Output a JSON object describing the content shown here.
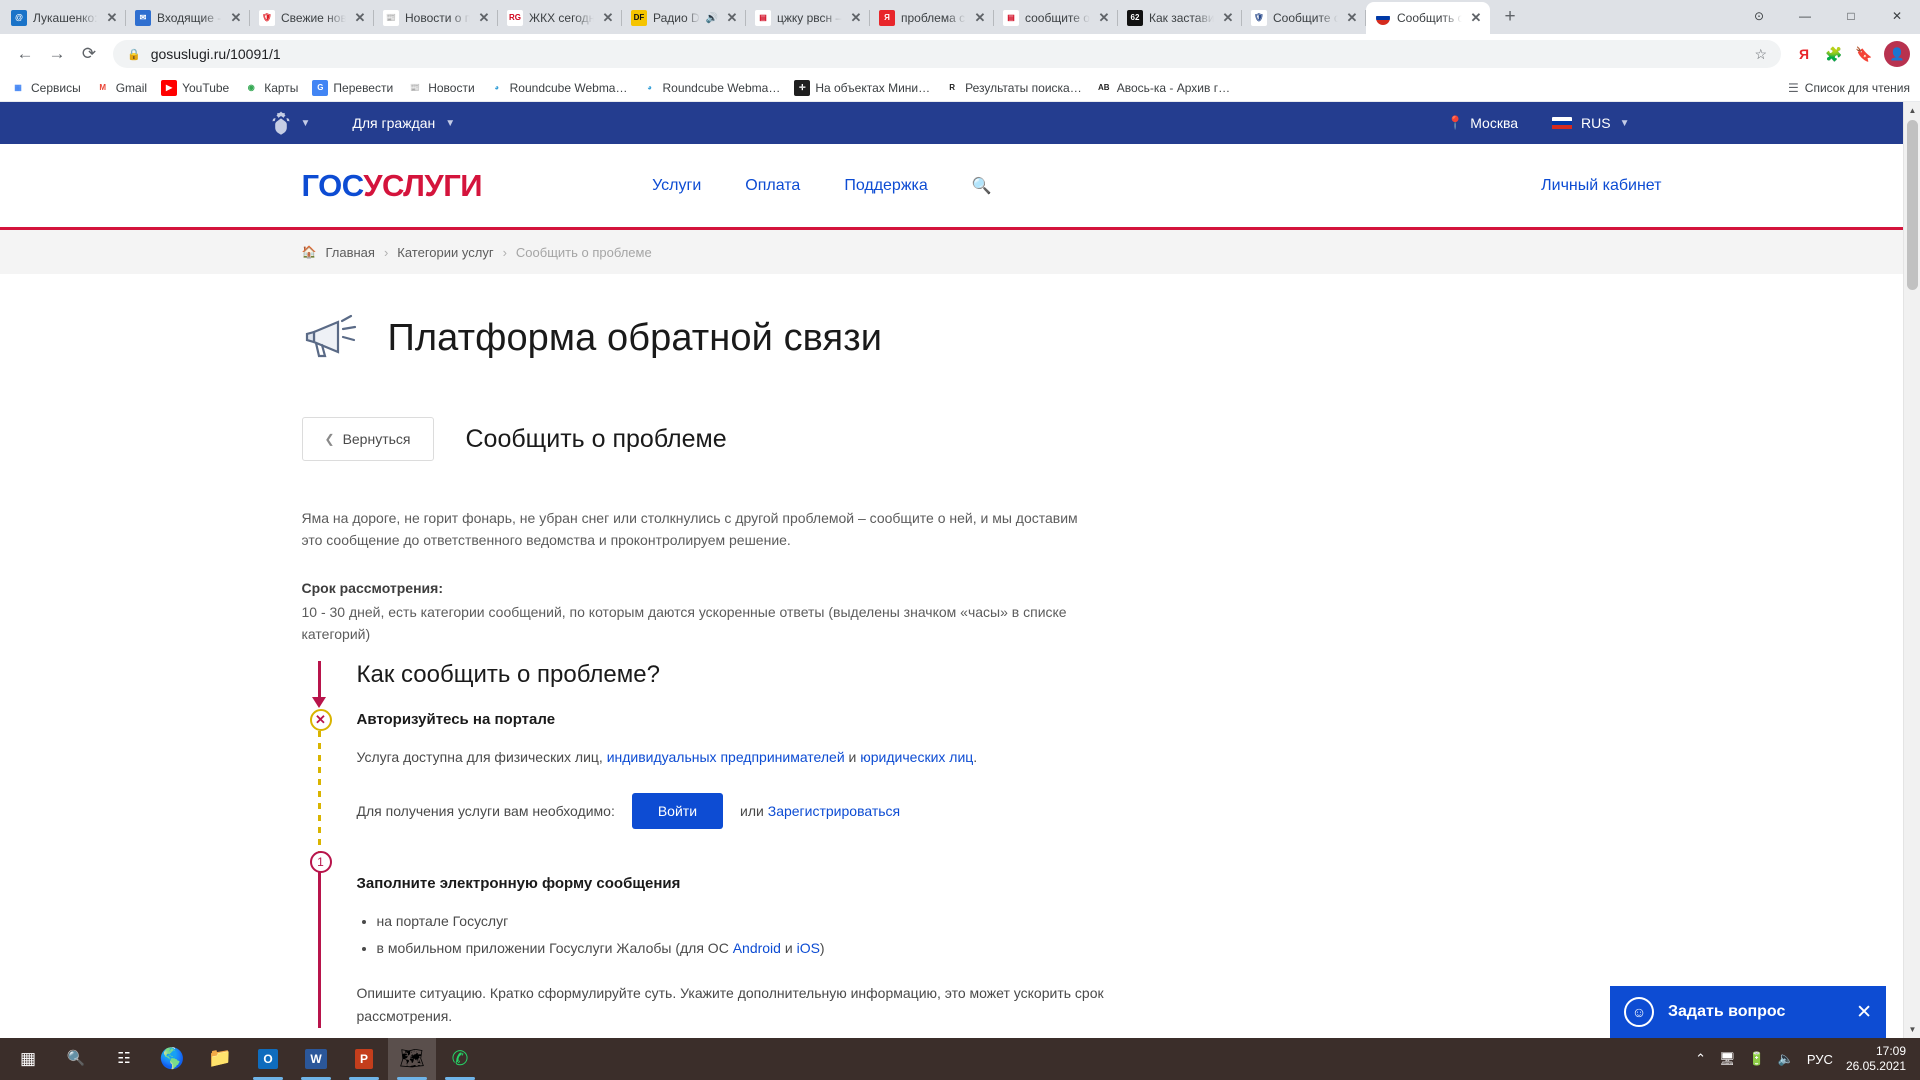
{
  "browser": {
    "tabs": [
      {
        "title": "Лукашенко: Г",
        "favicon": "at-blue",
        "active": false
      },
      {
        "title": "Входящие - П",
        "favicon": "mail-blue",
        "active": false
      },
      {
        "title": "Свежие новос",
        "favicon": "shield-red",
        "active": false
      },
      {
        "title": "Новости о по",
        "favicon": "news-red",
        "active": false
      },
      {
        "title": "ЖКХ сегодня",
        "favicon": "rg-ru",
        "active": false
      },
      {
        "title": "Радио DF",
        "favicon": "dfm-yellow",
        "active": false,
        "audio": true
      },
      {
        "title": "цжку рвсн – Я",
        "favicon": "doc-red",
        "active": false
      },
      {
        "title": "проблема си",
        "favicon": "yandex-red",
        "active": false
      },
      {
        "title": "сообщите о п",
        "favicon": "doc-red",
        "active": false
      },
      {
        "title": "Как заставить",
        "favicon": "sixtytwo",
        "active": false
      },
      {
        "title": "Сообщите о п",
        "favicon": "emblem-blue",
        "active": false
      },
      {
        "title": "Сообщить о п",
        "favicon": "ru-flag",
        "active": true
      }
    ],
    "newtab_label": "+",
    "window_controls": {
      "minimize": "—",
      "maximize": "□",
      "close": "✕",
      "extra": "⊙"
    },
    "nav": {
      "back": "←",
      "forward": "→",
      "reload": "⟳"
    },
    "omnibox": {
      "lock_icon": "lock-icon",
      "url": "gosuslugi.ru/10091/1",
      "star_icon": "star-icon"
    },
    "toolbar_icons": [
      "yandex-icon",
      "extensions-icon",
      "readinglist-icon",
      "profile-avatar"
    ],
    "bookmarks": [
      {
        "label": "Сервисы",
        "icon": "apps-grid"
      },
      {
        "label": "Gmail",
        "icon": "gmail"
      },
      {
        "label": "YouTube",
        "icon": "youtube"
      },
      {
        "label": "Карты",
        "icon": "maps"
      },
      {
        "label": "Перевести",
        "icon": "translate"
      },
      {
        "label": "Новости",
        "icon": "news"
      },
      {
        "label": "Roundcube Webma…",
        "icon": "roundcube"
      },
      {
        "label": "Roundcube Webma…",
        "icon": "roundcube"
      },
      {
        "label": "На объектах Мини…",
        "icon": "plus-black"
      },
      {
        "label": "Результаты поиска…",
        "icon": "r-serif"
      },
      {
        "label": "Авось-ка - Архив г…",
        "icon": "ab-bold"
      }
    ],
    "reading_list_label": "Список для чтения"
  },
  "site": {
    "topbar": {
      "emblem_name": "russian-coat-of-arms",
      "audience": "Для граждан",
      "city": "Москва",
      "lang": "RUS"
    },
    "logo": {
      "part1": "ГОС",
      "part2": "УСЛУГИ"
    },
    "nav": [
      {
        "label": "Услуги"
      },
      {
        "label": "Оплата"
      },
      {
        "label": "Поддержка"
      }
    ],
    "search_icon": "search-icon",
    "account_label": "Личный кабинет",
    "breadcrumbs": [
      {
        "label": "Главная",
        "current": false
      },
      {
        "label": "Категории услуг",
        "current": false
      },
      {
        "label": "Сообщить о проблеме",
        "current": true
      }
    ],
    "breadcrumb_separator": "›",
    "platform_title": "Платформа обратной связи",
    "back_button": "Вернуться",
    "page_heading": "Сообщить о проблеме",
    "intro": "Яма на дороге, не горит фонарь, не убран снег или столкнулись с другой проблемой – сообщите о ней, и мы доставим это сообщение до ответственного ведомства и проконтролируем решение.",
    "term_label": "Срок рассмотрения:",
    "term_text": "10 - 30 дней, есть категории сообщений, по которым даются ускоренные ответы (выделены значком «часы» в списке категорий)",
    "how_heading": "Как сообщить о проблеме?",
    "step_auth": {
      "marker": "✕",
      "title": "Авторизуйтесь на портале",
      "line_prefix": "Услуга доступна для физических лиц, ",
      "link1": "индивидуальных предпринимателей",
      "line_mid": " и ",
      "link2": "юридических лиц",
      "line_suffix": ".",
      "need_label": "Для получения услуги вам необходимо:",
      "login_button": "Войти",
      "or_label": "или",
      "register_link": "Зарегистрироваться"
    },
    "step_one": {
      "marker": "1",
      "title": "Заполните электронную форму сообщения",
      "bullets": [
        {
          "prefix": "на портале Госуслуг",
          "link1": "",
          "mid": "",
          "link2": "",
          "suffix": ""
        },
        {
          "prefix": "в мобильном приложении Госуслуги Жалобы (для ОС ",
          "link1": "Android",
          "mid": " и ",
          "link2": "iOS",
          "suffix": ")"
        }
      ],
      "note": "Опишите ситуацию. Кратко сформулируйте суть. Укажите дополнительную информацию, это может ускорить срок рассмотрения."
    },
    "chat": {
      "label": "Задать вопрос",
      "smiley": "smiley-icon",
      "close": "✕"
    }
  },
  "taskbar": {
    "items": [
      {
        "name": "start-button",
        "icon": "windows-logo"
      },
      {
        "name": "search-button",
        "icon": "magnifier"
      },
      {
        "name": "task-view-button",
        "icon": "task-view"
      },
      {
        "name": "edge-button",
        "icon": "edge"
      },
      {
        "name": "explorer-button",
        "icon": "folder"
      },
      {
        "name": "outlook-button",
        "icon": "outlook",
        "running": true
      },
      {
        "name": "word-button",
        "icon": "word",
        "running": true
      },
      {
        "name": "powerpoint-button",
        "icon": "powerpoint",
        "running": true
      },
      {
        "name": "chrome-button",
        "icon": "chrome",
        "running": true,
        "active": true
      },
      {
        "name": "whatsapp-button",
        "icon": "whatsapp",
        "running": true
      }
    ],
    "tray": {
      "chevron": "⌃",
      "icons": [
        "monitor-icon",
        "battery-icon",
        "volume-icon"
      ],
      "language": "РУС",
      "time": "17:09",
      "date": "26.05.2021"
    }
  }
}
